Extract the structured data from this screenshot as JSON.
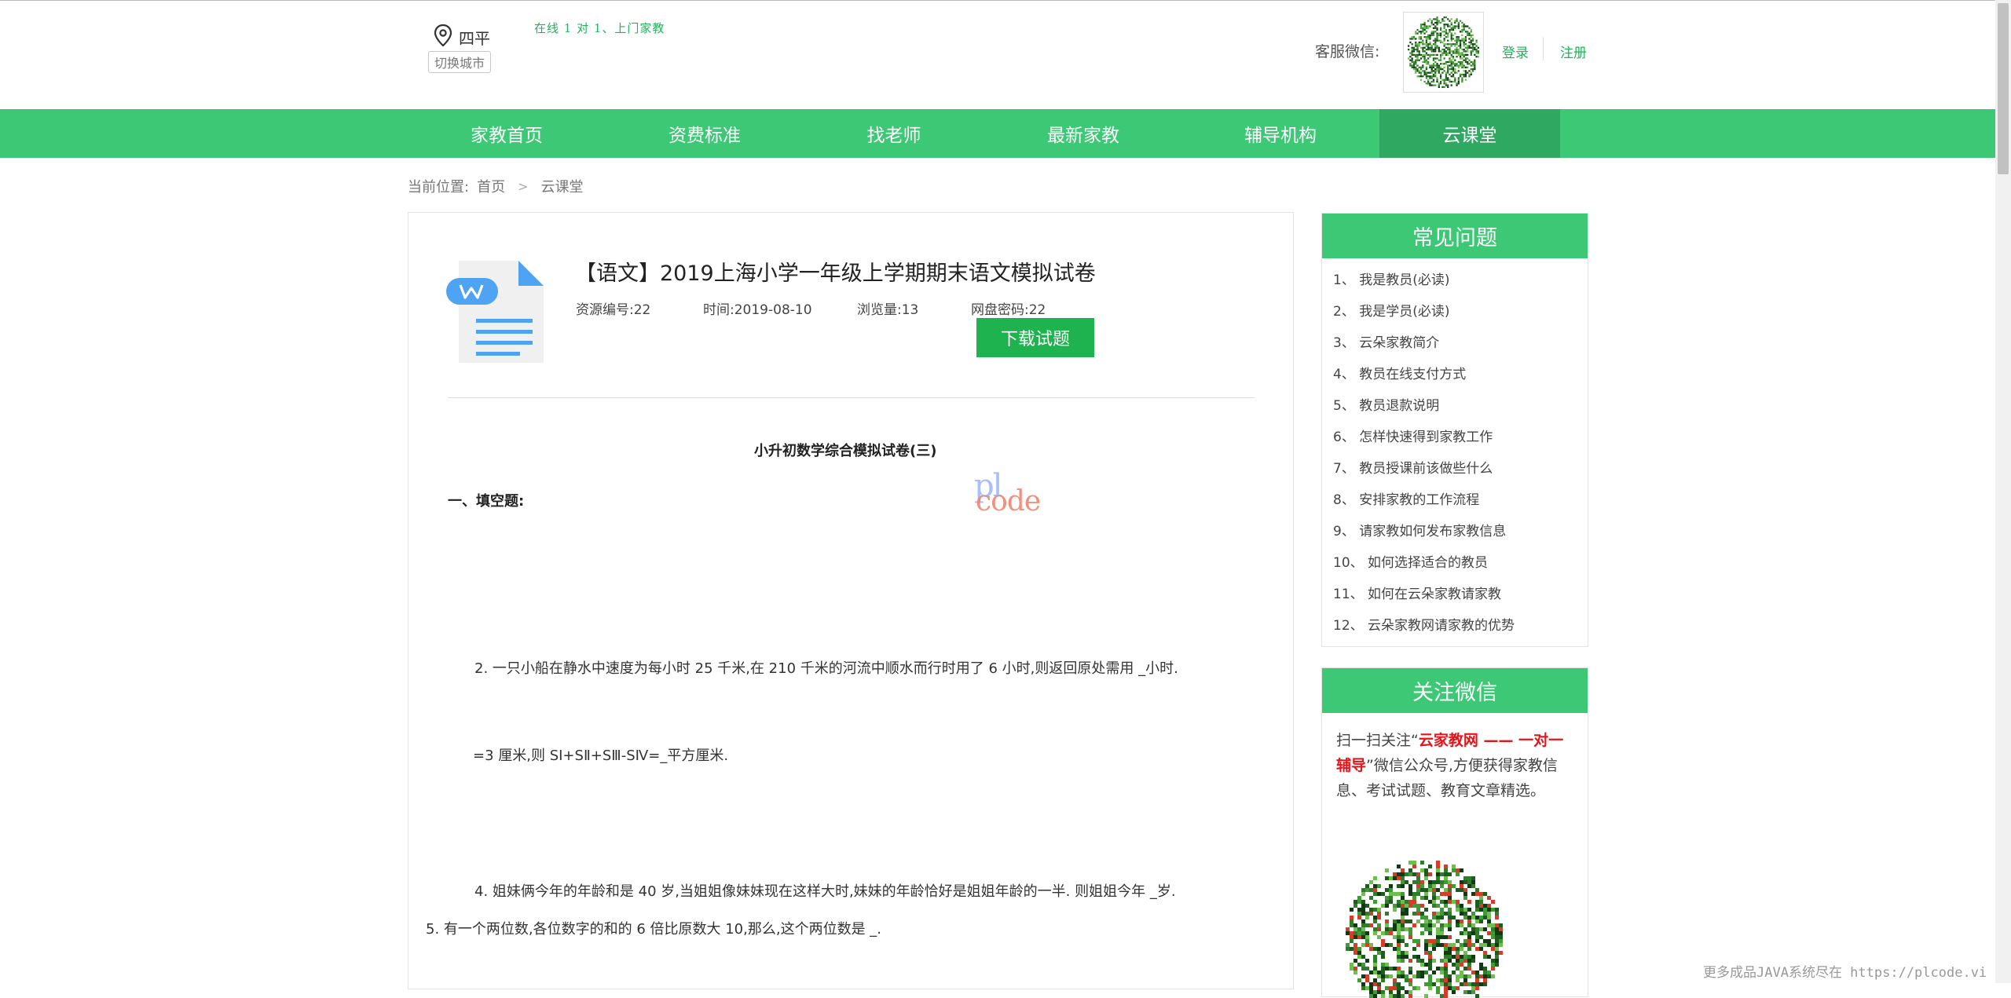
{
  "header": {
    "city": "四平",
    "switch_city": "切换城市",
    "slogan": "在线 1 对 1、上门家教",
    "service_label": "客服微信:",
    "login": "登录",
    "register": "注册"
  },
  "nav": {
    "items": [
      {
        "label": "家教首页"
      },
      {
        "label": "资费标准"
      },
      {
        "label": "找老师"
      },
      {
        "label": "最新家教"
      },
      {
        "label": "辅导机构"
      },
      {
        "label": "云课堂"
      }
    ],
    "active_index": 5,
    "bg_color": "#3cc875",
    "active_color": "#2fa862"
  },
  "breadcrumb": {
    "prefix": "当前位置:",
    "home": "首页",
    "separator": ">",
    "current": "云课堂"
  },
  "article": {
    "title": "【语文】2019上海小学一年级上学期期末语文模拟试卷",
    "resource_id": "资源编号:22",
    "date": "时间:2019-08-10",
    "views": "浏览量:13",
    "disk_password": "网盘密码:22",
    "download_label": "下载试题",
    "doc_heading": "小升初数学综合模拟试卷(三)",
    "section_title": "一、填空题:",
    "questions": [
      "2. 一只小船在静水中速度为每小时 25 千米,在 210 千米的河流中顺水而行时用了 6 小时,则返回原处需用 _小时.",
      "=3 厘米,则 SⅠ+SⅡ+SⅢ-SⅣ=_平方厘米.",
      "4. 姐妹俩今年的年龄和是 40 岁,当姐姐像妹妹现在这样大时,妹妹的年龄恰好是姐姐年龄的一半. 则姐姐今年 _岁.",
      "5. 有一个两位数,各位数字的和的 6 倍比原数大 10,那么,这个两位数是 _."
    ]
  },
  "watermark": {
    "top": "pl",
    "bottom": "code",
    "footer": "更多成品JAVA系统尽在 https://plcode.vi"
  },
  "faq": {
    "title": "常见问题",
    "items": [
      "1、 我是教员(必读)",
      "2、 我是学员(必读)",
      "3、 云朵家教简介",
      "4、 教员在线支付方式",
      "5、 教员退款说明",
      "6、 怎样快速得到家教工作",
      "7、 教员授课前该做些什么",
      "8、 安排家教的工作流程",
      "9、 请家教如何发布家教信息",
      "10、 如何选择适合的教员",
      "11、 如何在云朵家教请家教",
      "12、 云朵家教网请家教的优势"
    ]
  },
  "wechat": {
    "title": "关注微信",
    "text_before": "扫一扫关注“",
    "highlight": "云家教网 —— 一对一辅导",
    "text_after": "”微信公众号,方便获得家教信息、考试试题、教育文章精选。"
  },
  "icons": {
    "location": "location-pin-icon",
    "document": "word-document-icon",
    "qr": "qr-code-icon"
  }
}
